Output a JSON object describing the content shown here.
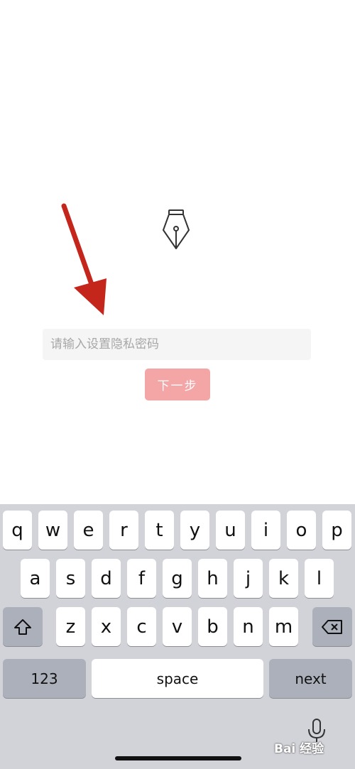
{
  "form": {
    "password_placeholder": "请输入设置隐私密码",
    "next_step_label": "下一步"
  },
  "keyboard": {
    "row1": [
      "q",
      "w",
      "e",
      "r",
      "t",
      "y",
      "u",
      "i",
      "o",
      "p"
    ],
    "row2": [
      "a",
      "s",
      "d",
      "f",
      "g",
      "h",
      "j",
      "k",
      "l"
    ],
    "row3": [
      "z",
      "x",
      "c",
      "v",
      "b",
      "n",
      "m"
    ],
    "numbers_label": "123",
    "space_label": "space",
    "next_label": "next"
  },
  "icons": {
    "pen": "fountain-pen-icon",
    "shift": "shift-icon",
    "backspace": "backspace-icon",
    "mic": "microphone-icon"
  },
  "watermark": "Bai 经验",
  "colors": {
    "button_disabled": "#f4a6a6",
    "arrow": "#c4261c",
    "keyboard_bg": "#d1d3d9"
  }
}
